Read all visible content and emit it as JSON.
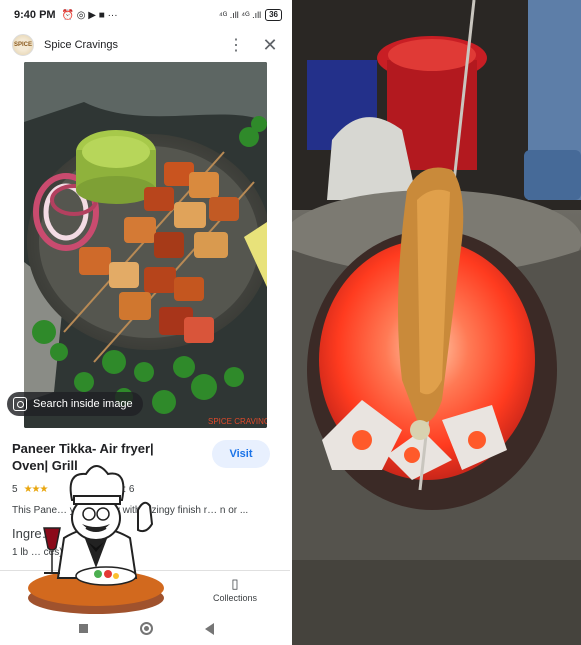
{
  "statusbar": {
    "time": "9:40 PM",
    "icons_left": "⏰ ◎ ▶ ■ ···",
    "network": "⁴ᴳ .ıll ⁴ᴳ .ıll",
    "battery": "36"
  },
  "appbar": {
    "site_name": "Spice Cravings",
    "logo_text": "SPICE",
    "menu_icon": "⋮",
    "close_icon": "✕"
  },
  "hero": {
    "search_inside_label": "Search inside image",
    "watermark": "SPICE CRAVINGS"
  },
  "result": {
    "title": "Paneer Tikka- Air fryer| Oven| Grill",
    "visit_label": "Visit",
    "rating": "5",
    "stars": "★★★",
    "yield": "Yield: 6",
    "description": "This Pane… y and spicy with a zingy finish r… n or ...",
    "ingredients_heading": "Ingre…",
    "ingredient_line": "1 lb … ces)"
  },
  "bottomnav": {
    "collections_label": "Collections",
    "collections_icon": "▯"
  },
  "colors": {
    "accent": "#1a73e8",
    "visit_bg": "#e8f0fe",
    "star": "#e9a60e",
    "fire": "#ff3b1f"
  }
}
